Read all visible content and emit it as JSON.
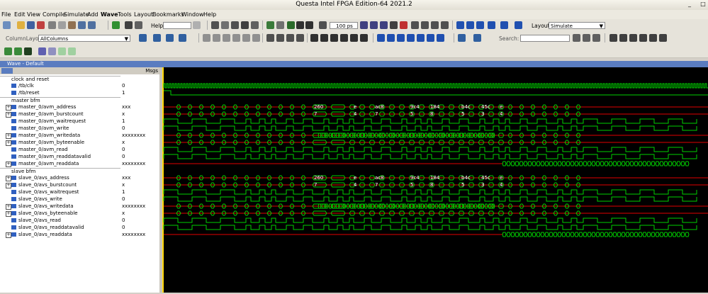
{
  "window": {
    "title": "Questa Intel FPGA Edition-64 2021.2"
  },
  "menu": [
    "File",
    "Edit",
    "View",
    "Compile",
    "Simulate",
    "Add",
    "Wave",
    "Tools",
    "Layout",
    "Bookmarks",
    "Window",
    "Help"
  ],
  "toolbar": {
    "help_label": "Help",
    "time_value": "100 ps",
    "layout_label": "Layout",
    "layout_value": "Simulate",
    "column_layout_label": "ColumnLayout",
    "column_layout_value": "AllColumns",
    "search_label": "Search:"
  },
  "wave_window": {
    "title": "Wave - Default",
    "msgs_header": "Msgs"
  },
  "groups": [
    "clock and reset",
    "master bfm",
    "slave bfm"
  ],
  "signals": [
    {
      "name": "/tb/clk",
      "value": "0",
      "expand": false,
      "group": 0
    },
    {
      "name": "/tb/reset",
      "value": "1",
      "expand": false,
      "group": 0
    },
    {
      "name": "master_0/avm_address",
      "value": "xxx",
      "expand": true,
      "group": 1
    },
    {
      "name": "master_0/avm_burstcount",
      "value": "x",
      "expand": true,
      "group": 1
    },
    {
      "name": "master_0/avm_waitrequest",
      "value": "1",
      "expand": false,
      "group": 1
    },
    {
      "name": "master_0/avm_write",
      "value": "0",
      "expand": false,
      "group": 1
    },
    {
      "name": "master_0/avm_writedata",
      "value": "xxxxxxxx",
      "expand": true,
      "group": 1
    },
    {
      "name": "master_0/avm_byteenable",
      "value": "x",
      "expand": true,
      "group": 1
    },
    {
      "name": "master_0/avm_read",
      "value": "0",
      "expand": false,
      "group": 1
    },
    {
      "name": "master_0/avm_readdatavalid",
      "value": "0",
      "expand": false,
      "group": 1
    },
    {
      "name": "master_0/avm_readdata",
      "value": "xxxxxxxx",
      "expand": true,
      "group": 1
    },
    {
      "name": "slave_0/avs_address",
      "value": "xxx",
      "expand": true,
      "group": 2
    },
    {
      "name": "slave_0/avs_burstcount",
      "value": "x",
      "expand": true,
      "group": 2
    },
    {
      "name": "slave_0/avs_waitrequest",
      "value": "1",
      "expand": false,
      "group": 2
    },
    {
      "name": "slave_0/avs_write",
      "value": "0",
      "expand": false,
      "group": 2
    },
    {
      "name": "slave_0/avs_writedata",
      "value": "xxxxxxxx",
      "expand": true,
      "group": 2
    },
    {
      "name": "slave_0/avs_byteenable",
      "value": "x",
      "expand": true,
      "group": 2
    },
    {
      "name": "slave_0/avs_read",
      "value": "0",
      "expand": false,
      "group": 2
    },
    {
      "name": "slave_0/avs_readdatavalid",
      "value": "0",
      "expand": false,
      "group": 2
    },
    {
      "name": "slave_0/avs_readdata",
      "value": "xxxxxxxx",
      "expand": true,
      "group": 2
    }
  ],
  "bus_labels": {
    "address": [
      "260",
      "e",
      "ac8",
      "9c4",
      "184",
      "b4c",
      "45c",
      "e"
    ],
    "burstcount": [
      "7",
      "4",
      "7",
      "5",
      "8",
      "5",
      "3",
      "4"
    ]
  },
  "colors": {
    "wave_green": "#00d000",
    "wave_red": "#e00000",
    "cursor": "#ffd700",
    "header_blue": "#5a7cc0"
  }
}
